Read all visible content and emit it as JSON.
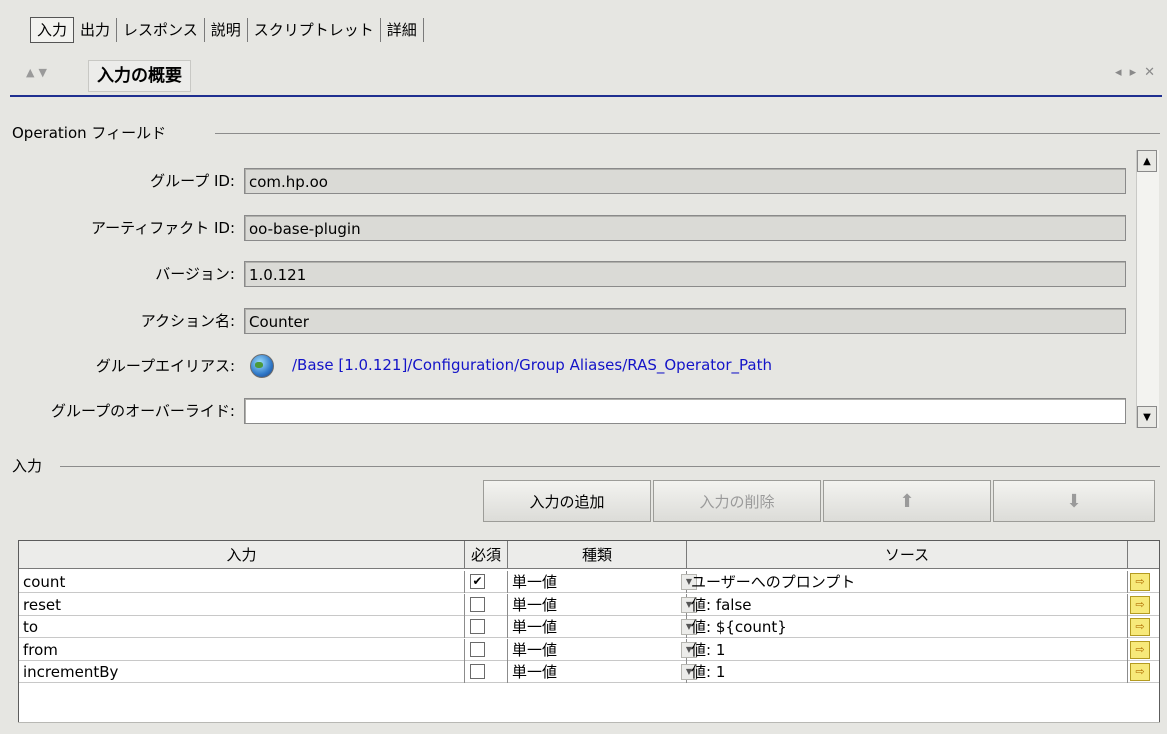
{
  "tabs": [
    "入力",
    "出力",
    "レスポンス",
    "説明",
    "スクリプトレット",
    "詳細"
  ],
  "header": {
    "title": "入力の概要"
  },
  "operation": {
    "group_title": "Operation フィールド",
    "fields": [
      {
        "label": "グループ ID:",
        "value": "com.hp.oo"
      },
      {
        "label": "アーティファクト ID:",
        "value": "oo-base-plugin"
      },
      {
        "label": "バージョン:",
        "value": "1.0.121"
      },
      {
        "label": "アクション名:",
        "value": "Counter"
      }
    ],
    "alias_label": "グループエイリアス:",
    "alias_value": "/Base [1.0.121]/Configuration/Group Aliases/RAS_Operator_Path",
    "override_label": "グループのオーバーライド:",
    "override_value": ""
  },
  "inputs": {
    "group_title": "入力",
    "buttons": {
      "add": "入力の追加",
      "remove": "入力の削除"
    },
    "columns": [
      "入力",
      "必須",
      "種類",
      "ソース"
    ],
    "rows": [
      {
        "name": "count",
        "required": true,
        "type": "単一値",
        "source": "ユーザーへのプロンプト"
      },
      {
        "name": "reset",
        "required": false,
        "type": "単一値",
        "source": "値: false"
      },
      {
        "name": "to",
        "required": false,
        "type": "単一値",
        "source": "値: ${count}"
      },
      {
        "name": "from",
        "required": false,
        "type": "単一値",
        "source": "値: 1"
      },
      {
        "name": "incrementBy",
        "required": false,
        "type": "単一値",
        "source": "値: 1"
      }
    ]
  },
  "colors": {
    "accent_line": "#1f2f90",
    "link": "#1414c8",
    "background": "#e6e6e2"
  },
  "icons": [
    "globe-icon",
    "move-up-icon",
    "move-down-icon",
    "source-select-icon"
  ]
}
